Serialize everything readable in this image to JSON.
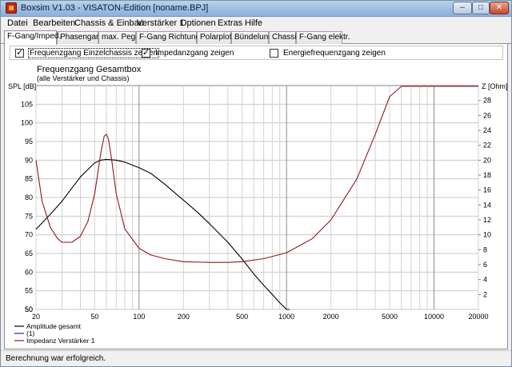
{
  "window": {
    "title": "Boxsim V1.03 - VISATON-Edition [noname.BPJ]",
    "buttons": {
      "minimize": "–",
      "maximize": "□",
      "close": "✕"
    }
  },
  "menu": [
    "Datei",
    "Bearbeiten",
    "Chassis & Einbau",
    "Verstärker 1",
    "Optionen",
    "Extras",
    "Hilfe"
  ],
  "tabs": [
    {
      "label": "F-Gang/Imped.",
      "active": true
    },
    {
      "label": "Phasengang",
      "active": false
    },
    {
      "label": "max. Pegel",
      "active": false
    },
    {
      "label": "F-Gang Richtungen",
      "active": false
    },
    {
      "label": "Polarplots",
      "active": false
    },
    {
      "label": "Bündelung",
      "active": false
    },
    {
      "label": "Chassis",
      "active": false
    },
    {
      "label": "F-Gang elektr.",
      "active": false
    }
  ],
  "checkboxes": [
    {
      "label": "Frequenzgang Einzelchassis zeigen",
      "checked": true
    },
    {
      "label": "Impedanzgang zeigen",
      "checked": true
    },
    {
      "label": "Energiefrequenzgang zeigen",
      "checked": false
    }
  ],
  "chart_data": {
    "type": "line",
    "title": "Frequenzgang Gesamtbox",
    "subtitle": "(alle Verstärker und Chassis)",
    "y_left_label": "SPL [dB]",
    "y_right_label": "Z [Ohm]",
    "x_scale": "log",
    "xlim": [
      20,
      20000
    ],
    "ylim_left": [
      50,
      110
    ],
    "ylim_right": [
      0,
      30
    ],
    "x_ticks": [
      20,
      50,
      100,
      200,
      500,
      1000,
      2000,
      5000,
      10000,
      20000
    ],
    "y_left_ticks": [
      50,
      55,
      60,
      65,
      70,
      75,
      80,
      85,
      90,
      95,
      100,
      105
    ],
    "y_right_ticks": [
      2,
      4,
      6,
      8,
      10,
      12,
      14,
      16,
      18,
      20,
      22,
      24,
      26,
      28
    ],
    "grid": true,
    "legend_position": "bottom-left",
    "series": [
      {
        "name": "Amplitude gesamt",
        "color": "#000000",
        "axis": "left",
        "x": [
          20,
          25,
          30,
          35,
          40,
          45,
          50,
          55,
          60,
          70,
          80,
          100,
          120,
          150,
          200,
          250,
          300,
          400,
          500,
          600,
          700,
          800,
          900,
          1000,
          1050
        ],
        "y": [
          71.5,
          75.5,
          79,
          82.5,
          85.5,
          87.5,
          89.3,
          90,
          90.2,
          90,
          89.5,
          88,
          86.5,
          83.5,
          79.3,
          76,
          73,
          68,
          63.5,
          59.5,
          56.5,
          54,
          51.8,
          50,
          50
        ]
      },
      {
        "name": "(1)",
        "color": "#2a2a9c",
        "axis": "left",
        "x": [],
        "y": []
      },
      {
        "name": "Impedanz Verstärker 1",
        "color": "#8b1a1a",
        "axis": "right",
        "x": [
          20,
          22,
          25,
          28,
          30,
          35,
          40,
          45,
          50,
          55,
          58,
          60,
          62,
          65,
          70,
          80,
          100,
          120,
          150,
          200,
          300,
          400,
          500,
          700,
          1000,
          1500,
          2000,
          3000,
          4000,
          5000,
          6000,
          6200,
          7000,
          10000,
          20000
        ],
        "y": [
          20,
          14.5,
          11,
          9.5,
          9,
          9,
          9.8,
          11.8,
          15.5,
          21,
          23.2,
          23.5,
          22.8,
          20.2,
          15.5,
          10.8,
          8.2,
          7.3,
          6.8,
          6.4,
          6.3,
          6.3,
          6.4,
          6.8,
          7.6,
          9.5,
          12,
          17.5,
          23.5,
          28.5,
          31,
          31,
          31,
          31,
          31
        ]
      }
    ]
  },
  "status": "Berechnung war erfolgreich."
}
